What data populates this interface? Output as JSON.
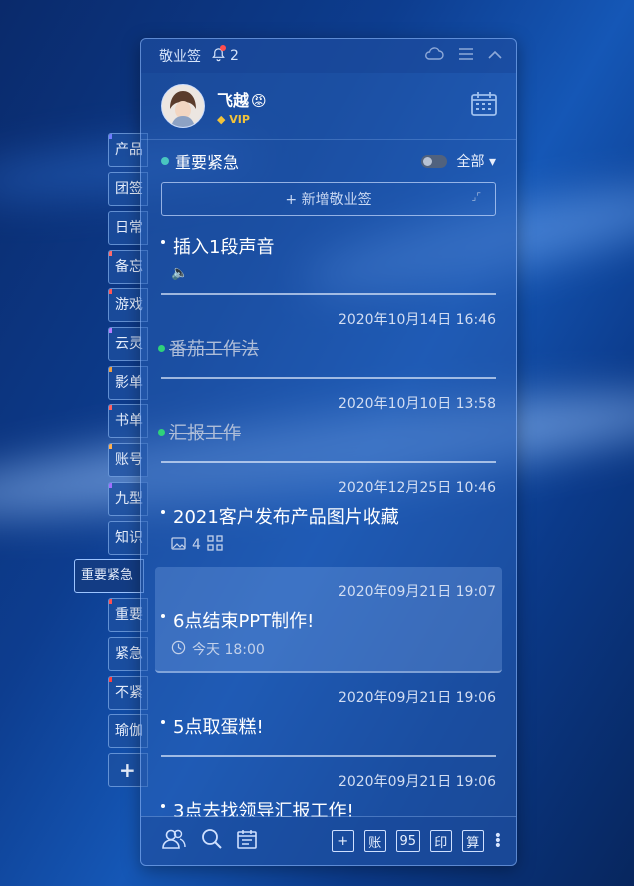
{
  "sidebar": {
    "tabs": [
      {
        "label": "产品",
        "marker": "#6f7cff"
      },
      {
        "label": "团签",
        "marker": ""
      },
      {
        "label": "日常",
        "marker": ""
      },
      {
        "label": "备忘",
        "marker": "#ff6b6b"
      },
      {
        "label": "游戏",
        "marker": "#ff5555"
      },
      {
        "label": "云灵",
        "marker": "#b47cff"
      },
      {
        "label": "影单",
        "marker": "#f0a040"
      },
      {
        "label": "书单",
        "marker": "#ff6060"
      },
      {
        "label": "账号",
        "marker": "#ffb050"
      },
      {
        "label": "九型",
        "marker": "#a070ff"
      },
      {
        "label": "知识",
        "marker": ""
      },
      {
        "label": "重要紧急",
        "marker": ""
      },
      {
        "label": "重要",
        "marker": "#ff5050"
      },
      {
        "label": "紧急",
        "marker": ""
      },
      {
        "label": "不紧",
        "marker": "#ff4040"
      },
      {
        "label": "瑜伽",
        "marker": ""
      }
    ],
    "active_index": 11,
    "add_label": "+"
  },
  "titlebar": {
    "title": "敬业签",
    "notification_count": "2",
    "icons": [
      "cloud-icon",
      "menu-icon",
      "collapse-icon"
    ]
  },
  "user": {
    "name": "飞越",
    "emoji": "😡",
    "badge": "VIP"
  },
  "filter": {
    "title": "重要紧急",
    "scope": "全部 ▾"
  },
  "add_note": {
    "label": "+ 新增敬业签",
    "expand_glyph": "⌟⌜"
  },
  "notes": [
    {
      "title": "插入1段声音",
      "timestamp": "",
      "done": false,
      "meta_icon": "audio-icon",
      "meta_text": "🔈"
    },
    {
      "title": "番茄工作法",
      "timestamp": "2020年10月14日 16:46",
      "done": true
    },
    {
      "title": "汇报工作",
      "timestamp": "2020年10月10日 13:58",
      "done": true
    },
    {
      "title": "2021客户发布产品图片收藏",
      "timestamp": "2020年12月25日 10:46",
      "done": false,
      "meta_icon": "image-icon",
      "meta_text": "4"
    },
    {
      "title": "6点结束PPT制作!",
      "timestamp": "2020年09月21日 19:07",
      "done": false,
      "meta_icon": "clock-icon",
      "meta_text": "今天 18:00"
    },
    {
      "title": "5点取蛋糕!",
      "timestamp": "2020年09月21日 19:06",
      "done": false
    },
    {
      "title": "3点去找领导汇报工作!",
      "timestamp": "2020年09月21日 19:06",
      "done": false
    }
  ],
  "bottombar": {
    "left_icons": [
      "contacts-icon",
      "search-icon",
      "calendar-list-icon"
    ],
    "buttons": [
      "+",
      "账",
      "95",
      "印",
      "算"
    ]
  }
}
